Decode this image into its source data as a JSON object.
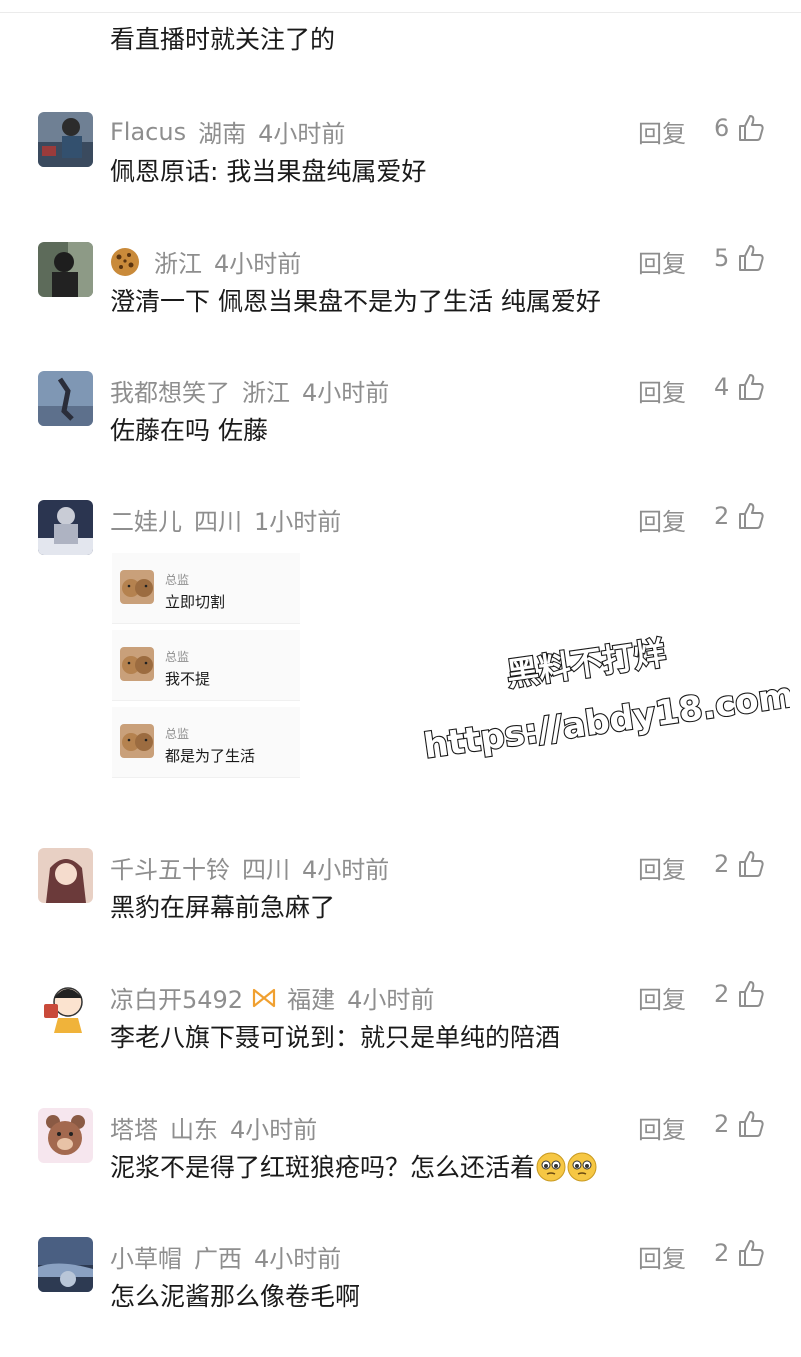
{
  "top_partial": {
    "text": "看直播时就关注了的"
  },
  "reply_label": "回复",
  "comments": [
    {
      "name": "Flacus",
      "location": "湖南",
      "time": "4小时前",
      "text": "佩恩原话: 我当果盘纯属爱好",
      "likes": "6"
    },
    {
      "name": "",
      "location": "浙江",
      "time": "4小时前",
      "text": "澄清一下 佩恩当果盘不是为了生活 纯属爱好",
      "likes": "5",
      "name_badge": "cookie-icon"
    },
    {
      "name": "我都想笑了",
      "location": "浙江",
      "time": "4小时前",
      "text": "佐藤在吗 佐藤",
      "likes": "4"
    },
    {
      "name": "二娃儿",
      "location": "四川",
      "time": "1小时前",
      "text": "",
      "likes": "2"
    },
    {
      "name": "千斗五十铃",
      "location": "四川",
      "time": "4小时前",
      "text": "黑豹在屏幕前急麻了",
      "likes": "2"
    },
    {
      "name": "凉白开5492",
      "location": "福建",
      "time": "4小时前",
      "text": "李老八旗下聂可说到：就只是单纯的陪酒",
      "likes": "2",
      "badge_after_name": "ribbon-icon"
    },
    {
      "name": "塔塔",
      "location": "山东",
      "time": "4小时前",
      "text": "泥浆不是得了红斑狼疮吗？怎么还活着",
      "likes": "2",
      "emojis": [
        "pleading-face-icon",
        "pleading-face-icon"
      ]
    },
    {
      "name": "小草帽",
      "location": "广西",
      "time": "4小时前",
      "text": "怎么泥酱那么像卷毛啊",
      "likes": "2"
    }
  ],
  "attachment_chat": [
    {
      "role": "总监",
      "message": "立即切割"
    },
    {
      "role": "总监",
      "message": "我不提"
    },
    {
      "role": "总监",
      "message": "都是为了生活"
    }
  ],
  "watermark": {
    "line1": "黑料不打烊",
    "line2": "https://abdy18.com"
  },
  "colors": {
    "meta_gray": "#8e8e8e",
    "text_dark": "#1a1a1a",
    "ribbon_orange": "#f0a030"
  }
}
